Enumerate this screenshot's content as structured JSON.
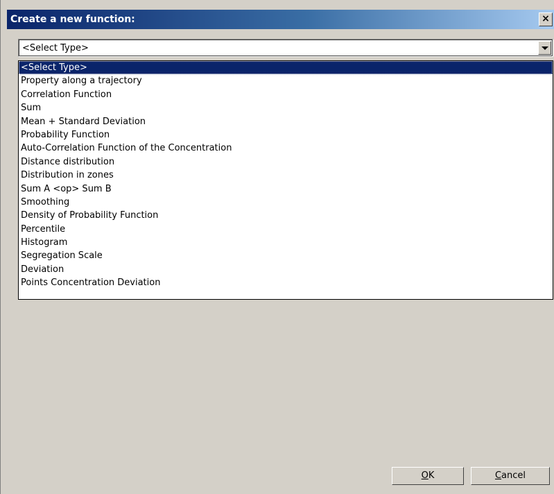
{
  "dialog": {
    "title": "Create a new function:",
    "close_label": "×"
  },
  "combo": {
    "selected": "<Select Type>",
    "icon": "chevron-down-icon"
  },
  "list": {
    "items": [
      {
        "label": "<Select Type>",
        "selected": true
      },
      {
        "label": "Property along a trajectory",
        "selected": false
      },
      {
        "label": "Correlation Function",
        "selected": false
      },
      {
        "label": "Sum",
        "selected": false
      },
      {
        "label": "Mean + Standard Deviation",
        "selected": false
      },
      {
        "label": "Probability Function",
        "selected": false
      },
      {
        "label": "Auto-Correlation Function of the Concentration",
        "selected": false
      },
      {
        "label": "Distance distribution",
        "selected": false
      },
      {
        "label": "Distribution in zones",
        "selected": false
      },
      {
        "label": "Sum A <op> Sum B",
        "selected": false
      },
      {
        "label": "Smoothing",
        "selected": false
      },
      {
        "label": "Density of Probability Function",
        "selected": false
      },
      {
        "label": "Percentile",
        "selected": false
      },
      {
        "label": "Histogram",
        "selected": false
      },
      {
        "label": "Segregation Scale",
        "selected": false
      },
      {
        "label": "Deviation",
        "selected": false
      },
      {
        "label": "Points Concentration Deviation",
        "selected": false
      }
    ]
  },
  "buttons": {
    "ok": {
      "mnemonic": "O",
      "rest": "K"
    },
    "cancel": {
      "mnemonic": "C",
      "rest": "ancel"
    }
  },
  "colors": {
    "title_start": "#0a246a",
    "title_end": "#a6caf0",
    "dialog_bg": "#d4d0c8",
    "selection": "#0a246a"
  }
}
